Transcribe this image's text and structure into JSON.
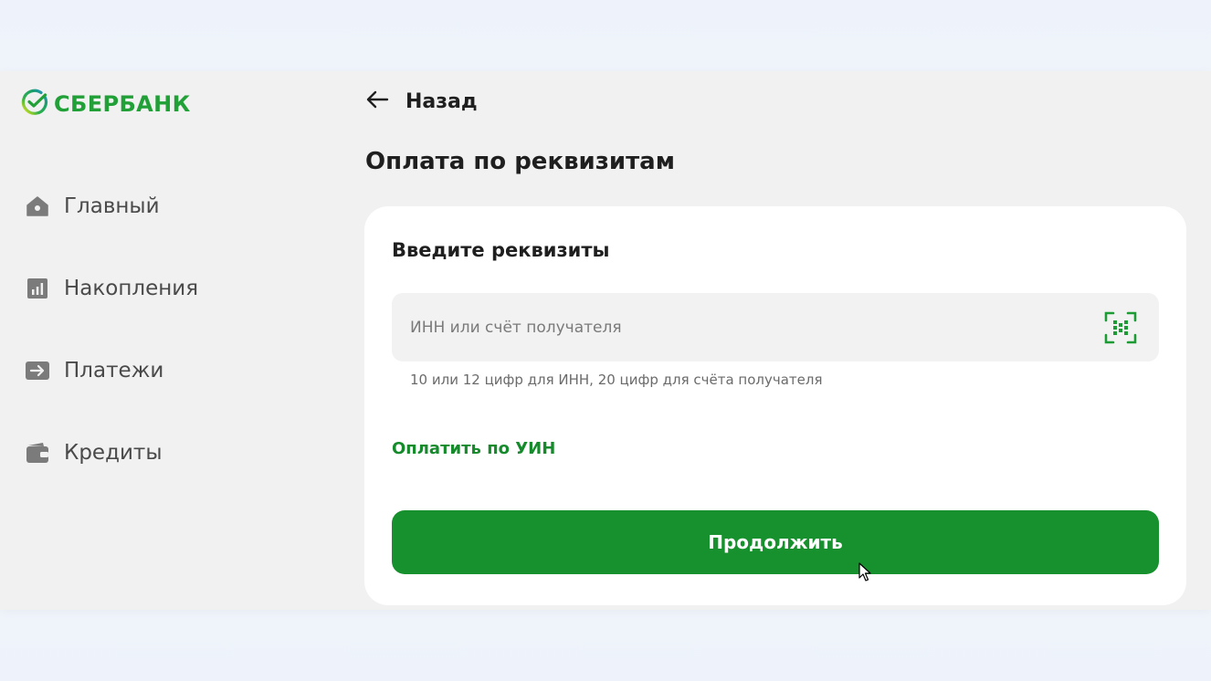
{
  "brand": {
    "name": "СБЕРБАНК",
    "logo_icon": "sber-logo-icon",
    "color": "#21a038"
  },
  "sidebar": {
    "items": [
      {
        "label": "Главный",
        "icon": "home-icon"
      },
      {
        "label": "Накопления",
        "icon": "chart-icon"
      },
      {
        "label": "Платежи",
        "icon": "arrow-right-icon"
      },
      {
        "label": "Кредиты",
        "icon": "wallet-icon"
      }
    ]
  },
  "header": {
    "back_label": "Назад",
    "back_icon": "arrow-left-icon",
    "title": "Оплата по реквизитам"
  },
  "form": {
    "title": "Введите реквизиты",
    "recipient_field": {
      "placeholder": "ИНН или счёт получателя",
      "value": "",
      "scan_icon": "qr-scan-icon"
    },
    "hint": "10 или 12 цифр для ИНН, 20 цифр для счёта получателя",
    "uin_link": "Оплатить по УИН",
    "continue_label": "Продолжить"
  },
  "colors": {
    "accent": "#17912e",
    "link": "#168b2c",
    "background": "#f1f1f1",
    "card": "#ffffff"
  }
}
